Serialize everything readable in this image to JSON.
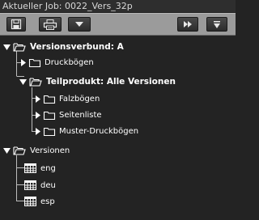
{
  "title": "Aktueller Job: 0022_Vers_32p",
  "toolbar": {
    "buttons": [
      {
        "icon": "save-icon"
      },
      {
        "icon": "print-icon"
      },
      {
        "icon": "chevron-down-icon"
      },
      {
        "icon": "fast-forward-icon"
      },
      {
        "icon": "collapse-icon"
      }
    ]
  },
  "tree": {
    "versionsverbund": "Versionsverbund: A",
    "druckboegen": "Druckbögen",
    "teilprodukt": "Teilprodukt: Alle Versionen",
    "falzboegen": "Falzbögen",
    "seitenliste": "Seitenliste",
    "muster_druckboegen": "Muster-Druckbögen",
    "versionen": "Versionen",
    "versions": [
      "eng",
      "deu",
      "esp"
    ]
  },
  "colors": {
    "background": "#232323",
    "toolbar": "#9b9b9b",
    "text": "#ffffff"
  }
}
